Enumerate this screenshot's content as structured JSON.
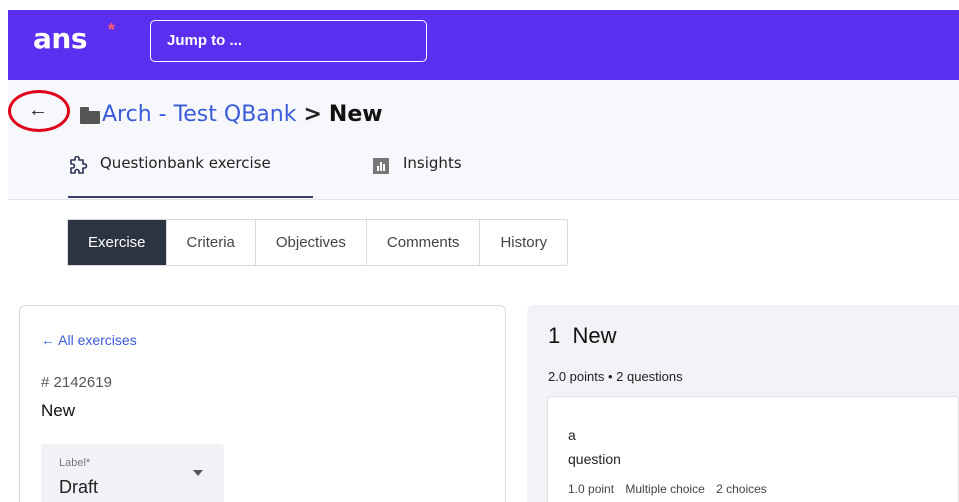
{
  "topbar": {
    "logo_text": "ans",
    "logo_star": "*",
    "jump_label": "Jump to ...",
    "accent_color": "#5a2ff0"
  },
  "header": {
    "back_icon": "←",
    "folder_icon": "folder-icon",
    "breadcrumb_link": "Arch - Test QBank",
    "breadcrumb_separator": ">",
    "breadcrumb_current": "New",
    "tabs": [
      {
        "label": "Questionbank exercise",
        "icon": "puzzle-icon",
        "active": true
      },
      {
        "label": "Insights",
        "icon": "insights-icon",
        "active": false
      }
    ]
  },
  "subtabs": [
    {
      "label": "Exercise",
      "active": true
    },
    {
      "label": "Criteria",
      "active": false
    },
    {
      "label": "Objectives",
      "active": false
    },
    {
      "label": "Comments",
      "active": false
    },
    {
      "label": "History",
      "active": false
    }
  ],
  "left_panel": {
    "back_link": "← All exercises",
    "exercise_id": "# 2142619",
    "exercise_title": "New",
    "label_field": {
      "caption": "Label*",
      "value": "Draft"
    }
  },
  "right_panel": {
    "heading_number": "1",
    "heading_title": "New",
    "summary": "2.0 points • 2 questions",
    "question": {
      "line1": "a",
      "line2": "question",
      "points": "1.0 point",
      "type": "Multiple choice",
      "choices": "2 choices"
    }
  }
}
